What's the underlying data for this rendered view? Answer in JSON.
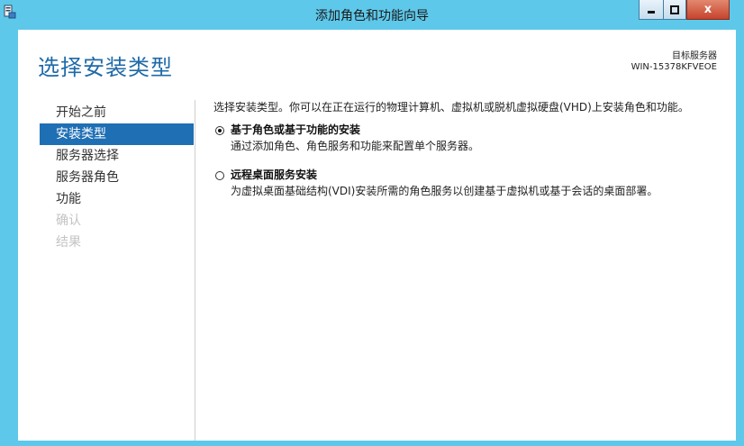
{
  "window": {
    "title": "添加角色和功能向导",
    "min_icon": "minimize-icon",
    "max_icon": "maximize-icon",
    "close_icon": "close-icon",
    "close_label": "x"
  },
  "header": {
    "page_title": "选择安装类型",
    "destination_label": "目标服务器",
    "destination_server": "WIN-15378KFVEOE"
  },
  "nav": {
    "items": [
      {
        "label": "开始之前",
        "state": "normal"
      },
      {
        "label": "安装类型",
        "state": "active"
      },
      {
        "label": "服务器选择",
        "state": "normal"
      },
      {
        "label": "服务器角色",
        "state": "normal"
      },
      {
        "label": "功能",
        "state": "normal"
      },
      {
        "label": "确认",
        "state": "disabled"
      },
      {
        "label": "结果",
        "state": "disabled"
      }
    ]
  },
  "main": {
    "intro": "选择安装类型。你可以在正在运行的物理计算机、虚拟机或脱机虚拟硬盘(VHD)上安装角色和功能。",
    "options": [
      {
        "title": "基于角色或基于功能的安装",
        "description": "通过添加角色、角色服务和功能来配置单个服务器。",
        "selected": true
      },
      {
        "title": "远程桌面服务安装",
        "description": "为虚拟桌面基础结构(VDI)安装所需的角色服务以创建基于虚拟机或基于会话的桌面部署。",
        "selected": false
      }
    ]
  },
  "colors": {
    "frame": "#5ec8ea",
    "accent": "#1f6aa8",
    "nav_active_bg": "#1f6fb4",
    "close_button": "#c7432c"
  }
}
